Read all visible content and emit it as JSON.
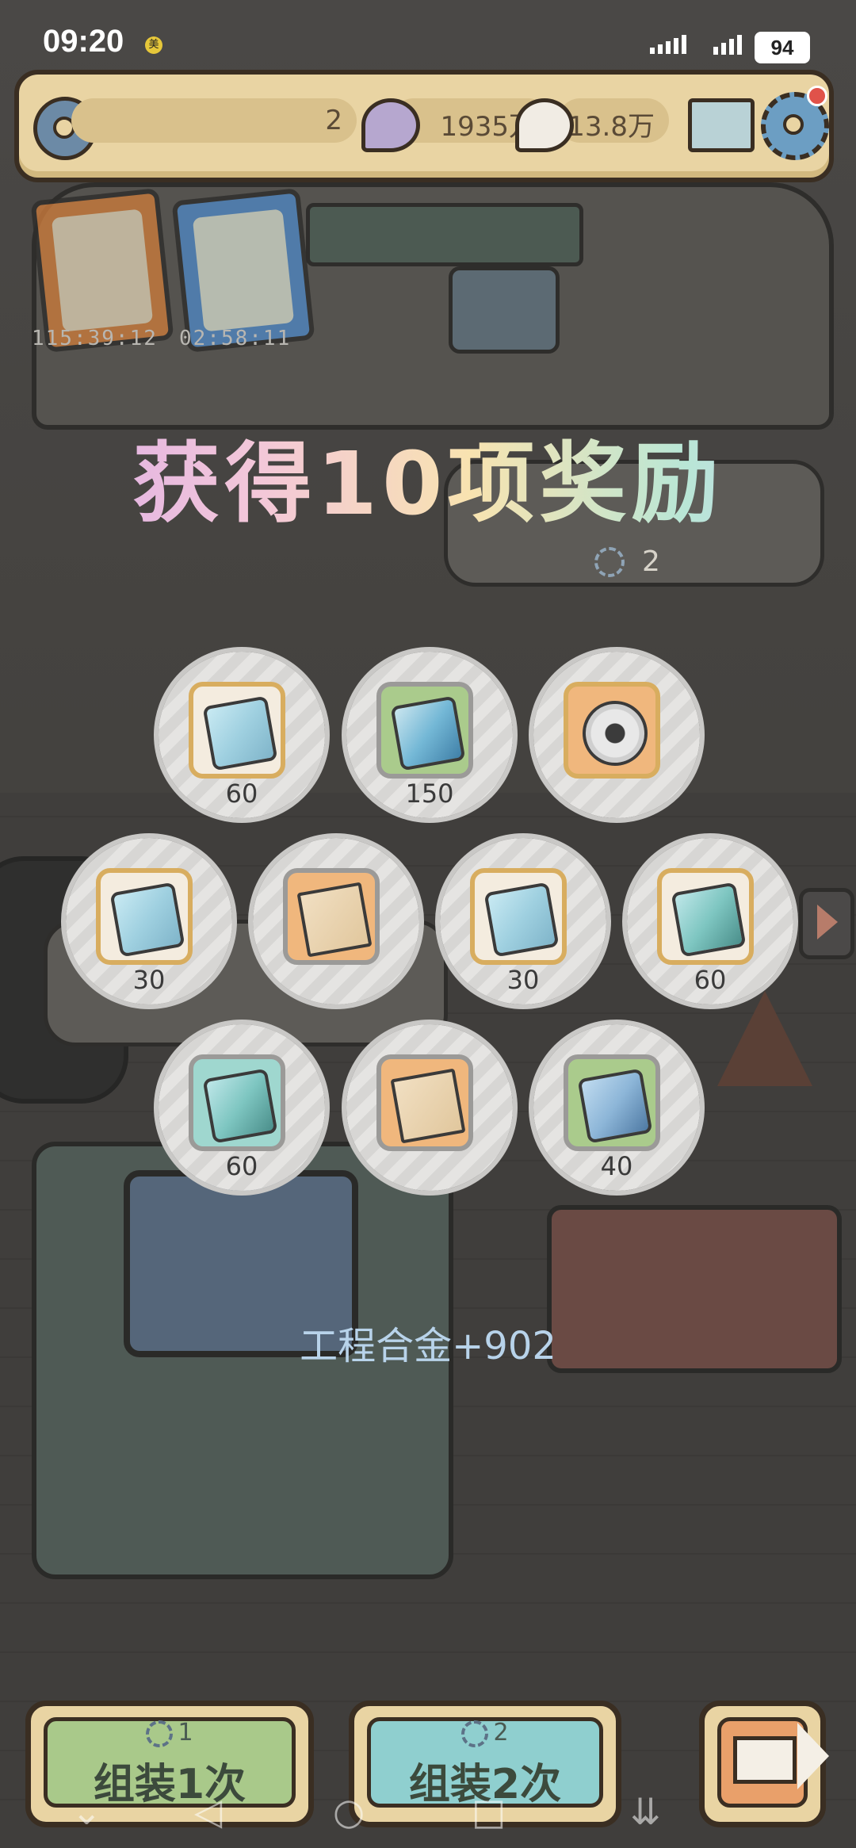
{
  "status_bar": {
    "time": "09:20",
    "battery": "94"
  },
  "resources": {
    "gears": "2",
    "currency_a": "1935万",
    "currency_b": "13.8万"
  },
  "timers": [
    {
      "time": "115:39:12"
    },
    {
      "time": "02:58:11"
    }
  ],
  "reward_panel": {
    "title": "获得10项奖励",
    "gear_count": "2",
    "rewards": [
      {
        "qty": "60",
        "item_icon": "ice-cube-icon"
      },
      {
        "qty": "150",
        "item_icon": "crystal-cube-icon"
      },
      {
        "qty": "",
        "item_icon": "orb-module-icon"
      },
      {
        "qty": "30",
        "item_icon": "ice-cube-icon"
      },
      {
        "qty": "",
        "item_icon": "blueprint-icon"
      },
      {
        "qty": "30",
        "item_icon": "ice-cube-icon"
      },
      {
        "qty": "60",
        "item_icon": "green-cube-icon"
      },
      {
        "qty": "60",
        "item_icon": "teal-cube-icon"
      },
      {
        "qty": "",
        "item_icon": "blueprint-icon"
      },
      {
        "qty": "40",
        "item_icon": "navy-cube-icon"
      }
    ],
    "bonus_text": "工程合金+902"
  },
  "buttons": {
    "assemble_1": {
      "cost": "1",
      "label": "组装1次"
    },
    "assemble_2": {
      "cost": "2",
      "label": "组装2次"
    }
  },
  "colors": {
    "panel_tan": "#e9d4a3",
    "outline": "#3a2e22",
    "btn_green": "#a9c98a",
    "btn_teal": "#8fcfcf",
    "btn_orange": "#e9a06a",
    "bonus_text": "#b8d3ea"
  }
}
